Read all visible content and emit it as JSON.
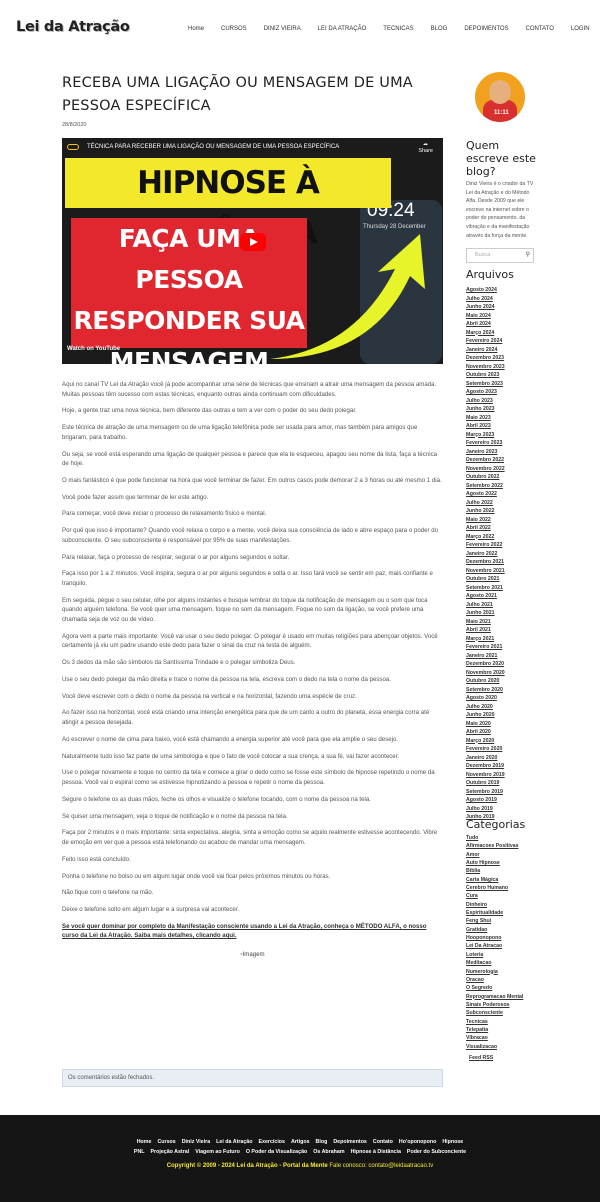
{
  "header": {
    "logo": "Lei da Atração",
    "nav": [
      "Home",
      "CURSOS",
      "DINIZ VIEIRA",
      "LEI DA ATRAÇÃO",
      "TECNICAS",
      "BLOG",
      "DEPOIMENTOS",
      "CONTATO",
      "LOGIN"
    ],
    "search_icon": "search-icon"
  },
  "post": {
    "title": "RECEBA UMA LIGAÇÃO OU MENSAGEM DE UMA PESSOA ESPECÍFICA",
    "date": "28/8/2020"
  },
  "video": {
    "title": "TÉCNICA PARA RECEBER UMA LIGAÇÃO OU MENSAGEM DE UMA PESSOA ESPECÍFICA",
    "share": "Share",
    "headline": "HIPNOSE À DISTÂNCIA",
    "overlay": "FAÇA UMA PESSOA RESPONDER SUA MENSAGEM",
    "clock": "09:24",
    "clock_date": "Thursday 28 December",
    "watch_on": "Watch on",
    "youtube": "YouTube"
  },
  "article": {
    "paragraphs": [
      "Aqui no canal TV Lei da Atração você já pode acompanhar uma série de técnicas que ensinam a atrair uma mensagem da pessoa amada. Muitas pessoas têm sucesso com estas técnicas, enquanto outras ainda continuam com dificuldades.",
      "Hoje, a gente traz uma nova técnica, bem diferente das outras e tem a ver com o poder do seu dedo polegar.",
      "Este técnica de atração de uma mensagem ou de uma ligação telefônica pode ser usada para amor, mas também para amigos que brigaram, para trabalho.",
      "Ou seja, se você está esperando uma ligação de qualquer pessoa e parece que ela te esqueceu, apagou seu nome da lista, faça a técnica de hoje.",
      "O mais fantástico é que pode funcionar na hora que você terminar de fazer. Em outros casos pode demorar 2 a 3 horas ou até mesmo 1 dia.",
      "Você pode fazer assim que terminar de ler este artigo.",
      "Para começar, você deve iniciar o processo de relaxamento físico e mental.",
      "Por quê que isso é importante? Quando você relaxa o corpo e a mente, você deixa sua consciência de lado e abre espaço para o poder do subconsciente. O seu subconsciente é responsável por 95% de suas manifestações.",
      "Para relaxar, faça o processo de respirar, segurar o ar por alguns segundos e soltar.",
      "Faça isso por 1 a 2 minutos. Você inspira, segura o ar por alguns segundos e solta o ar. Isso fará você se sentir em paz, mais confiante e tranquilo.",
      "Em seguida, pegue o seu celular, olhe por alguns instantes e busque lembrar do toque da notificação de mensagem ou o som que toca quando  alguém telefona. Se você quer uma mensagem, foque no som da mensagem. Foque no som da ligação, se você prefere uma chamada seja de voz ou de vídeo.",
      "Agora vem a parte mais importante: Você vai usar o seu dedo polegar. O polegar é usado em muitas religiões para abençoar objetos. Você certamente já viu um padre usando este dedo para fazer o sinal da cruz na testa de alguém.",
      "Os 3 dedos da mão são símbolos da Santíssima Trindade e o polegar simboliza Deus.",
      "Use o seu dedo polegar da mão direita e trace o nome da pessoa na tela, escreva com o dedo na tela o nome da pessoa.",
      "Você deve escrever com o dedo o nome da pessoa na vertical e na horizontal, fazendo uma espécie de cruz.",
      " Ao fazer isso na horizontal, você está criando uma intenção energética para que de um canto a outro do planeta, essa energia corra até atingir a pessoa desejada.",
      "Ao escrever o nome de cima para baixo, você está chamando a energia superior até você para que ela amplie o seu desejo.",
      "Naturalmente tudo isso faz parte de uma simbologia e que o fato de você colocar a sua crença, a sua fé, vai fazer acontecer.",
      "Use o polegar novamente e toque no centro da tela e comece a girar o dedo como se fosse este símbolo de hipnose repetindo o nome da pessoa. Você vai o espiral como se estivesse hipnotizando a pessoa e repetir o nome da pessoa.",
      "Segure o telefone os as duas mãos, feche os olhos e visualize o telefone tocando, com o nome da pessoa na tela.",
      "Se quiser uma mensagem, veja o toque de notificação e o nome da pessoa na tela.",
      "Faça por 2 minutos e o mais importante: sinta expectativa, alegria, sinta a emoção como se aquilo realmente estivesse acontecendo. Vibre de emoção em ver que a pessoa está telefonando ou acabou de mandar uma mensagem.",
      "Feito isso está concluído.",
      "Ponha o telefone no bolso ou em algum lugar onde você vai ficar pelos próximos minutos ou horas.",
      "Não fique com o telefone na mão.",
      "Deixe o telefone solto em algum lugar e a surpresa vai acontecer."
    ],
    "cta": "Se você quer dominar por completo da Manifestação consciente usando a Lei da Atração, conheça o MÉTODO ALFA, o nosso curso da Lei da Atração. Saiba mais detalhes, clicando aqui.",
    "image_alt": "Imagem"
  },
  "comments_closed": "Os comentários estão fechados.",
  "sidebar": {
    "about_heading": "Quem escreve este blog?",
    "about_text": "Diniz Vieira é o criador da TV Lei da Atração e do Método Alfa. Desde 2009 que ele escreve na internet sobre o poder do pensamento, da vibração e da manifestação através da força da mente.",
    "avatar_text": "11:11",
    "search_placeholder": "Busca",
    "archives_heading": "Arquivos",
    "archives": [
      "Agosto 2024",
      "Julho 2024",
      "Junho 2024",
      "Maio 2024",
      "Abril 2024",
      "Março 2024",
      "Fevereiro 2024",
      "Janeiro 2024",
      "Dezembro 2023",
      "Novembro 2023",
      "Outubro 2023",
      "Setembro 2023",
      "Agosto 2023",
      "Julho 2023",
      "Junho 2023",
      "Maio 2023",
      "Abril 2023",
      "Março 2023",
      "Fevereiro 2023",
      "Janeiro 2023",
      "Dezembro 2022",
      "Novembro 2022",
      "Outubro 2022",
      "Setembro 2022",
      "Agosto 2022",
      "Julho 2022",
      "Junho 2022",
      "Maio 2022",
      "Abril 2022",
      "Março 2022",
      "Fevereiro 2022",
      "Janeiro 2022",
      "Dezembro 2021",
      "Novembro 2021",
      "Outubro 2021",
      "Setembro 2021",
      "Agosto 2021",
      "Julho 2021",
      "Junho 2021",
      "Maio 2021",
      "Abril 2021",
      "Março 2021",
      "Fevereiro 2021",
      "Janeiro 2021",
      "Dezembro 2020",
      "Novembro 2020",
      "Outubro 2020",
      "Setembro 2020",
      "Agosto 2020",
      "Julho 2020",
      "Junho 2020",
      "Maio 2020",
      "Abril 2020",
      "Março 2020",
      "Fevereiro 2020",
      "Janeiro 2020",
      "Dezembro 2019",
      "Novembro 2019",
      "Outubro 2019",
      "Setembro 2019",
      "Agosto 2019",
      "Julho 2019",
      "Junho 2019"
    ],
    "categories_heading": "Categorias",
    "categories": [
      "Tudo",
      "Afirmacoes Positivas",
      "Amor",
      "Auto Hipnose",
      "Bíblia",
      "Carta Mágica",
      "Cerebro Humano",
      "Cura",
      "Dinheiro",
      "Espiritualidade",
      "Feng Shui",
      "Gratidao",
      "Hooponopono",
      "Lei Da Atracao",
      "Loteria",
      "Meditacao",
      "Numerologia",
      "Oracao",
      "O Segredo",
      "Reprogramacao Mental",
      "Sinais Poderosos",
      "Subconsciente",
      "Tecnicas",
      "Telepatia",
      "Vibracao",
      "Visualizacao"
    ],
    "feed": "Feed RSS"
  },
  "footer": {
    "links_row1": [
      "Home",
      "Cursos",
      "Diniz Vieira",
      "Lei da Atração",
      "Exercícios",
      "Artigos",
      "Blog",
      "Depoimentos",
      "Contato",
      "Ho'oponopono",
      "Hipnose"
    ],
    "links_row2": [
      "PNL",
      "Projeção Astral",
      "Viagem ao Futuro",
      "O Poder da Visualização",
      "Os Abraham",
      "Hipnose à Distância",
      "Poder do Subconciente"
    ],
    "copyright": "Copyright © 2009 - 2024 Lei da Atração - Portal da Mente",
    "contact": "Fale conosco: contato@leidaatracao.tv"
  },
  "colors": {
    "accent_yellow": "#f3e82a",
    "accent_red": "#e0262e",
    "footer_bg": "#151515",
    "footer_text_yellow": "#f5ea30"
  }
}
